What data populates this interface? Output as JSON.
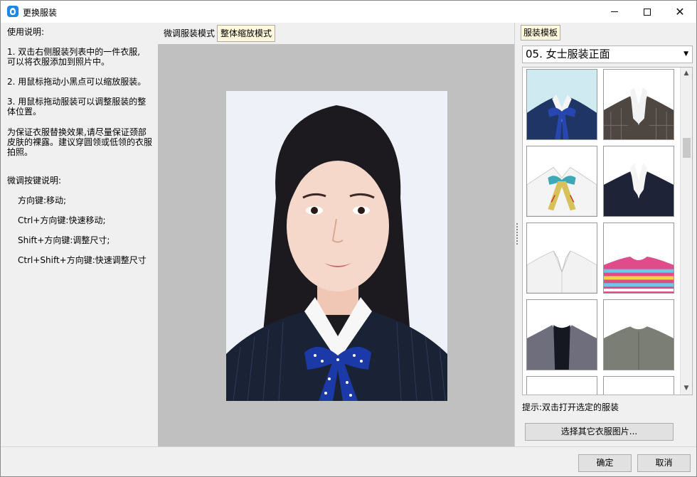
{
  "window": {
    "title": "更换服装",
    "icons": {
      "app": "app-logo-icon",
      "minimize": "minimize-icon",
      "maximize": "maximize-icon",
      "close": "close-icon"
    }
  },
  "help": {
    "heading": "使用说明:",
    "step1_a": "1. 双击右侧服装列表中的一件衣服,",
    "step1_b": "可以将衣服添加到照片中。",
    "step2": "2. 用鼠标拖动小黑点可以缩放服装。",
    "step3_a": "3. 用鼠标拖动服装可以调整服装的整",
    "step3_b": "体位置。",
    "note_a": "为保证衣服替换效果,请尽量保证颈部",
    "note_b": "皮肤的裸露。建议穿圆领或低领的衣服",
    "note_c": "拍照。",
    "keys_heading": "微调按键说明:",
    "key1": "方向键:移动;",
    "key2": "Ctrl+方向键:快速移动;",
    "key3": "Shift+方向键:调整尺寸;",
    "key4": "Ctrl+Shift+方向键:快速调整尺寸"
  },
  "center": {
    "tabs": [
      "微调服装模式",
      "整体缩放模式"
    ],
    "active_tab": "整体缩放模式"
  },
  "right": {
    "tab_label": "服装模板",
    "category": "05. 女士服装正面",
    "hint": "提示:双击打开选定的服装",
    "pick_button": "选择其它衣服图片..."
  },
  "footer": {
    "ok": "确定",
    "cancel": "取消"
  },
  "colors": {
    "active_tab_bg": "#fff8dc",
    "canvas_bg": "#c0c0c0",
    "accent": "#1e88e5"
  }
}
